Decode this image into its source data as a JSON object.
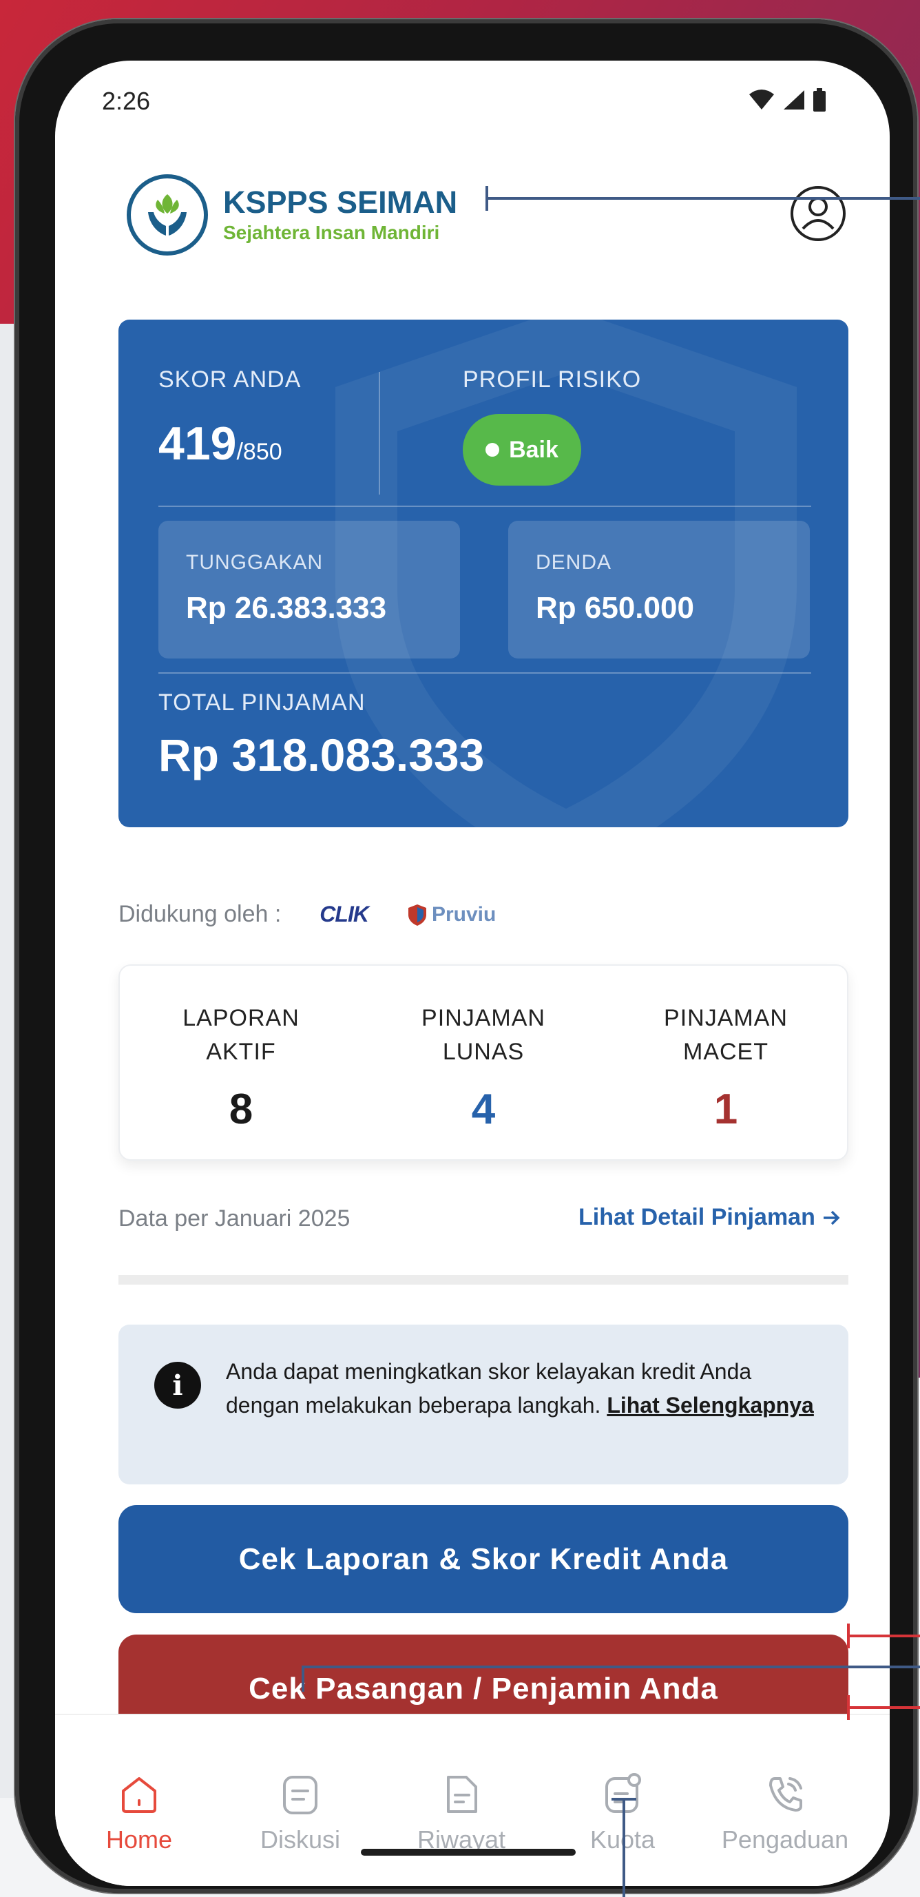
{
  "status_bar": {
    "time": "2:26"
  },
  "header": {
    "org_name": "KSPPS SEIMAN",
    "org_tagline": "Sejahtera Insan Mandiri"
  },
  "score_card": {
    "score_label": "SKOR ANDA",
    "score_value": "419",
    "score_max": "/850",
    "risk_label": "PROFIL RISIKO",
    "risk_value": "Baik",
    "arrears_label": "TUNGGAKAN",
    "arrears_value": "Rp 26.383.333",
    "penalty_label": "DENDA",
    "penalty_value": "Rp 650.000",
    "total_label": "TOTAL PINJAMAN",
    "total_value": "Rp 318.083.333"
  },
  "supported_by": {
    "label": "Didukung oleh :",
    "partners": [
      "CLIK",
      "Pruviu"
    ]
  },
  "stats": [
    {
      "label_line1": "LAPORAN",
      "label_line2": "AKTIF",
      "value": "8",
      "color": "#1a1a1a"
    },
    {
      "label_line1": "PINJAMAN",
      "label_line2": "LUNAS",
      "value": "4",
      "color": "#2762ab"
    },
    {
      "label_line1": "PINJAMAN",
      "label_line2": "MACET",
      "value": "1",
      "color": "#a53230"
    }
  ],
  "data_date": "Data per Januari 2025",
  "detail_link": "Lihat Detail Pinjaman",
  "info": {
    "text": "Anda dapat meningkatkan skor kelayakan kredit Anda dengan melakukan beberapa langkah.",
    "link": "Lihat Selengkapnya"
  },
  "buttons": {
    "check_report": "Cek Laporan & Skor Kredit Anda",
    "check_partner": "Cek Pasangan / Penjamin Anda"
  },
  "nav": [
    {
      "label": "Home",
      "icon": "home-icon",
      "active": true
    },
    {
      "label": "Diskusi",
      "icon": "discussion-icon",
      "active": false
    },
    {
      "label": "Riwayat",
      "icon": "history-icon",
      "active": false
    },
    {
      "label": "Kuota",
      "icon": "quota-icon",
      "active": false
    },
    {
      "label": "Pengaduan",
      "icon": "phone-icon",
      "active": false
    }
  ],
  "colors": {
    "primary_blue": "#2762ab",
    "risk_green": "#57b94a",
    "danger_red": "#a53230",
    "nav_active": "#e64a3c"
  }
}
